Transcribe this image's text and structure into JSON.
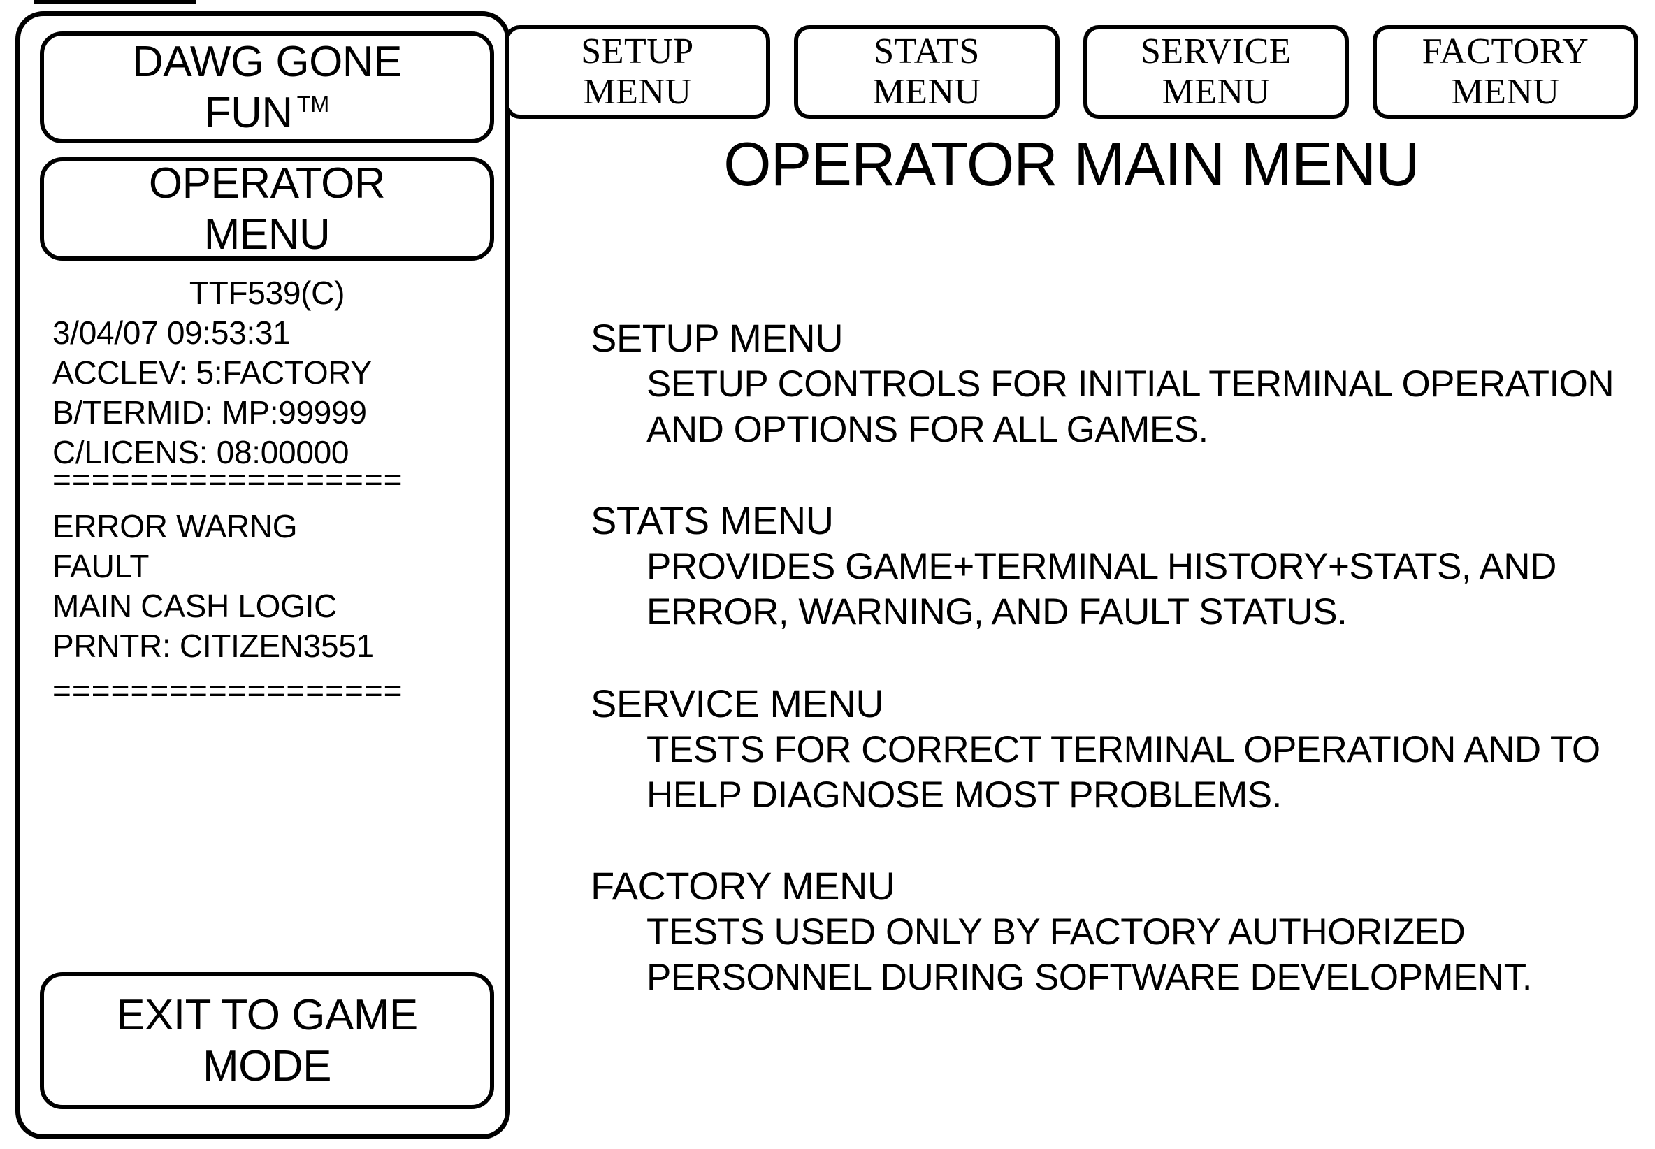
{
  "left_panel": {
    "title_button": {
      "line1": "DAWG GONE",
      "line2": "FUN",
      "trademark": "TM"
    },
    "operator_button": {
      "line1": "OPERATOR",
      "line2": "MENU"
    },
    "info": {
      "version": "TTF539(C)",
      "datetime": "3/04/07 09:53:31",
      "acclev": "ACCLEV: 5:FACTORY",
      "termid": "B/TERMID: MP:99999",
      "licens": "C/LICENS: 08:00000"
    },
    "separator": "==================",
    "status": {
      "line1": "ERROR WARNG",
      "line2": "FAULT",
      "line3": "MAIN CASH LOGIC",
      "line4": "PRNTR: CITIZEN3551"
    },
    "exit_button": {
      "line1": "EXIT TO GAME",
      "line2": "MODE"
    }
  },
  "menu_buttons": [
    {
      "line1": "SETUP",
      "line2": "MENU"
    },
    {
      "line1": "STATS",
      "line2": "MENU"
    },
    {
      "line1": "SERVICE",
      "line2": "MENU"
    },
    {
      "line1": "FACTORY",
      "line2": "MENU"
    }
  ],
  "main": {
    "title": "OPERATOR MAIN MENU",
    "sections": [
      {
        "heading": "SETUP MENU",
        "body_line1": "SETUP CONTROLS FOR INITIAL TERMINAL OPERATION",
        "body_line2": "AND OPTIONS FOR ALL GAMES."
      },
      {
        "heading": "STATS MENU",
        "body_line1": "PROVIDES GAME+TERMINAL HISTORY+STATS, AND",
        "body_line2": "ERROR, WARNING, AND FAULT STATUS."
      },
      {
        "heading": "SERVICE MENU",
        "body_line1": "TESTS FOR CORRECT TERMINAL OPERATION AND TO",
        "body_line2": "HELP DIAGNOSE MOST PROBLEMS."
      },
      {
        "heading": "FACTORY MENU",
        "body_line1": "TESTS USED ONLY BY FACTORY AUTHORIZED",
        "body_line2": "PERSONNEL DURING SOFTWARE DEVELOPMENT."
      }
    ]
  },
  "colors": {
    "ink": "#000000",
    "paper": "#ffffff"
  }
}
